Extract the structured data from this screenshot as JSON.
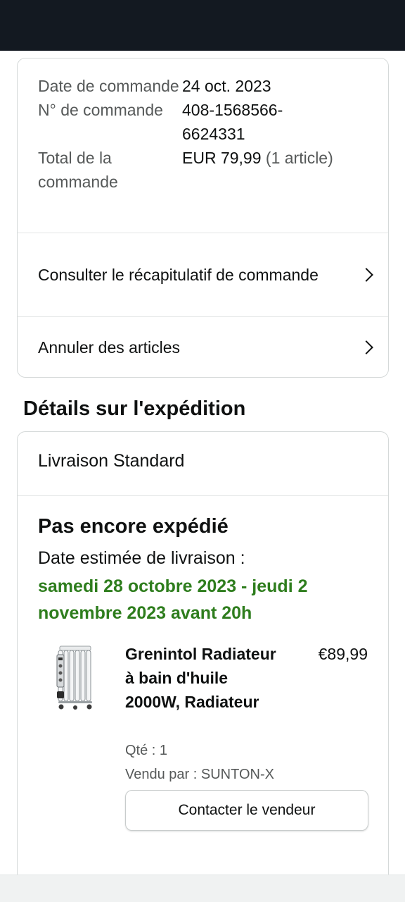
{
  "order": {
    "date_label": "Date de commande",
    "date_value": "24 oct. 2023",
    "number_label": "N° de commande",
    "number_value": "408-1568566-6624331",
    "total_label": "Total de la commande",
    "total_value": "EUR 79,99",
    "total_items": "(1 article)"
  },
  "links": {
    "summary": "Consulter le récapitulatif de commande",
    "cancel": "Annuler des articles"
  },
  "shipping": {
    "section_title": "Détails sur l'expédition",
    "method": "Livraison Standard",
    "status": "Pas encore expédié",
    "estimate_label": "Date estimée de livraison :",
    "estimate_value": "samedi 28 octobre 2023 - jeudi 2 novembre 2023 avant 20h"
  },
  "product": {
    "title": "Grenintol Radiateur à bain d'huile 2000W, Radiateur",
    "price": "€89,99",
    "qty": "Qté : 1",
    "seller": "Vendu par : SUNTON-X",
    "contact_button": "Contacter le vendeur",
    "image_icon": "oil-radiator-image"
  },
  "colors": {
    "status_bar": "#131921",
    "delivery_green": "#2e7d1d",
    "muted_text": "#565959"
  }
}
